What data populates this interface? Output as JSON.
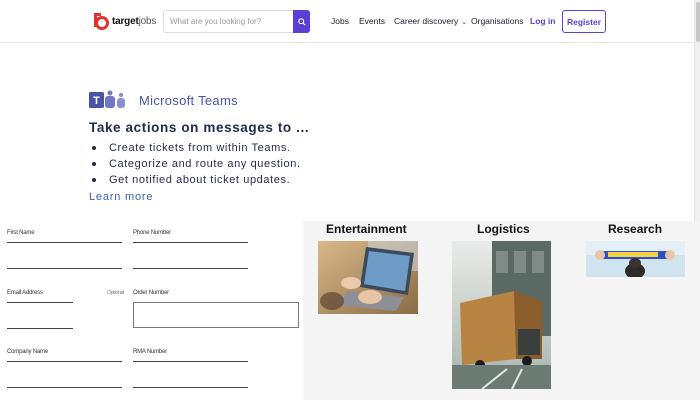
{
  "header": {
    "logo": {
      "bold": "target",
      "light": "jobs"
    },
    "search": {
      "placeholder": "What are you looking for?"
    },
    "nav": {
      "jobs": "Jobs",
      "events": "Events",
      "career_discovery": "Career discovery",
      "organisations": "Organisations",
      "login": "Log in",
      "register": "Register"
    }
  },
  "teams_banner": {
    "brand": "Microsoft Teams",
    "title": "Take actions on messages to ...",
    "items": [
      "Create tickets from within Teams.",
      "Categorize and route any question.",
      "Get notified about ticket updates."
    ],
    "link": "Learn more"
  },
  "form": {
    "first_name": "First Name",
    "phone_number": "Phone Number",
    "email_address": "Email Address",
    "optional": "Optional",
    "order_number": "Order Number",
    "company_name": "Company Name",
    "rma_number": "RMA Number"
  },
  "gallery": {
    "categories": [
      {
        "title": "Entertainment"
      },
      {
        "title": "Logistics"
      },
      {
        "title": "Research"
      }
    ]
  },
  "colors": {
    "brand_purple": "#5b3fd6",
    "teams_purple": "#4b55a5",
    "logo_red": "#e0332e",
    "link_blue": "#3c63b4"
  },
  "icons": {
    "logo": "target-logo-icon",
    "search": "search-icon",
    "caret": "chevron-down-icon",
    "teams": "microsoft-teams-icon"
  }
}
